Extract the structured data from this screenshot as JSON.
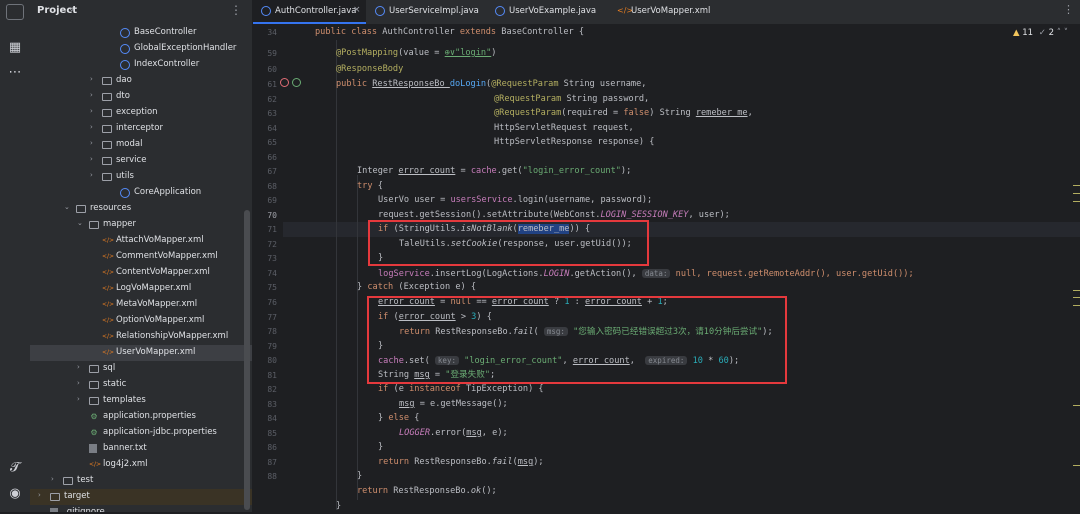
{
  "project_panel": {
    "title": "Project",
    "tree": [
      {
        "label": "BaseController",
        "kind": "class"
      },
      {
        "label": "GlobalExceptionHandler",
        "kind": "class"
      },
      {
        "label": "IndexController",
        "kind": "class"
      },
      {
        "label": "dao",
        "kind": "folder"
      },
      {
        "label": "dto",
        "kind": "folder"
      },
      {
        "label": "exception",
        "kind": "folder"
      },
      {
        "label": "interceptor",
        "kind": "folder"
      },
      {
        "label": "modal",
        "kind": "folder"
      },
      {
        "label": "service",
        "kind": "folder"
      },
      {
        "label": "utils",
        "kind": "folder"
      },
      {
        "label": "CoreApplication",
        "kind": "class"
      },
      {
        "label": "resources",
        "kind": "folder"
      },
      {
        "label": "mapper",
        "kind": "folder"
      },
      {
        "label": "AttachVoMapper.xml",
        "kind": "xml"
      },
      {
        "label": "CommentVoMapper.xml",
        "kind": "xml"
      },
      {
        "label": "ContentVoMapper.xml",
        "kind": "xml"
      },
      {
        "label": "LogVoMapper.xml",
        "kind": "xml"
      },
      {
        "label": "MetaVoMapper.xml",
        "kind": "xml"
      },
      {
        "label": "OptionVoMapper.xml",
        "kind": "xml"
      },
      {
        "label": "RelationshipVoMapper.xml",
        "kind": "xml"
      },
      {
        "label": "UserVoMapper.xml",
        "kind": "xml"
      },
      {
        "label": "sql",
        "kind": "folder"
      },
      {
        "label": "static",
        "kind": "folder"
      },
      {
        "label": "templates",
        "kind": "folder"
      },
      {
        "label": "application.properties",
        "kind": "prop"
      },
      {
        "label": "application-jdbc.properties",
        "kind": "prop"
      },
      {
        "label": "banner.txt",
        "kind": "txt"
      },
      {
        "label": "log4j2.xml",
        "kind": "xml"
      },
      {
        "label": "test",
        "kind": "folder"
      },
      {
        "label": "target",
        "kind": "folder"
      },
      {
        "label": ".gitignore",
        "kind": "txt"
      }
    ]
  },
  "tabs": [
    {
      "label": "AuthController.java"
    },
    {
      "label": "UserServiceImpl.java"
    },
    {
      "label": "UserVoExample.java"
    },
    {
      "label": "UserVoMapper.xml"
    }
  ],
  "inspections": {
    "warnings": "11",
    "weak": "2"
  },
  "editor": {
    "line_numbers": [
      "34",
      "59",
      "60",
      "61",
      "62",
      "63",
      "64",
      "65",
      "66",
      "67",
      "68",
      "69",
      "70",
      "71",
      "72",
      "73",
      "74",
      "75",
      "76",
      "77",
      "78",
      "79",
      "80",
      "81",
      "82",
      "83",
      "84",
      "85",
      "86",
      "87",
      "88"
    ],
    "code": {
      "l34a": "public class ",
      "l34b": "AuthController ",
      "l34c": "extends ",
      "l34d": "BaseController {",
      "l59a": "@PostMapping",
      "l59b": "(value = ",
      "l59c": "⊕∨\"login\"",
      "l59d": ")",
      "l60": "@ResponseBody",
      "l61a": "public ",
      "l61b": "RestResponseBo ",
      "l61c": "doLogin",
      "l61d": "(",
      "l61e": "@RequestParam ",
      "l61f": "String username,",
      "l62a": "@RequestParam ",
      "l62b": "String password,",
      "l63a": "@RequestParam",
      "l63b": "(required = ",
      "l63c": "false",
      "l63d": ") String ",
      "l63e": "remeber_me",
      "l63f": ",",
      "l64": "HttpServletRequest request,",
      "l65": "HttpServletResponse response) {",
      "l67a": "Integer ",
      "l67b": "error_count",
      "l67c": " = ",
      "l67d": "cache",
      "l67e": ".get(",
      "l67f": "\"login_error_count\"",
      "l67g": ");",
      "l68a": "try",
      "l68b": " {",
      "l69a": "UserVo user = ",
      "l69b": "usersService",
      "l69c": ".login(username, password);",
      "l70a": "request.getSession().setAttribute(WebConst.",
      "l70b": "LOGIN_SESSION_KEY",
      "l70c": ", user);",
      "l71a": "if",
      "l71b": " (StringUtils.",
      "l71c": "isNotBlank",
      "l71d": "(",
      "l71e": "remeber_me",
      "l71f": ")) {",
      "l72a": "TaleUtils.",
      "l72b": "setCookie",
      "l72c": "(response, user.getUid());",
      "l73": "}",
      "l74a": "logService",
      "l74b": ".insertLog(LogActions.",
      "l74c": "LOGIN",
      "l74d": ".getAction(), ",
      "l74e": "data:",
      "l74f": " null, request.getRemoteAddr(), user.getUid());",
      "l75a": "} ",
      "l75b": "catch",
      "l75c": " (Exception e) {",
      "l76a": "error_count",
      "l76b": " = ",
      "l76c": "null",
      "l76d": " == ",
      "l76e": "error_count",
      "l76f": " ? ",
      "l76g": "1",
      "l76h": " : ",
      "l76i": "error_count",
      "l76j": " + ",
      "l76k": "1",
      "l76l": ";",
      "l77a": "if",
      "l77b": " (",
      "l77c": "error_count",
      "l77d": " > ",
      "l77e": "3",
      "l77f": ") {",
      "l78a": "return ",
      "l78b": "RestResponseBo.",
      "l78c": "fail",
      "l78d": "( ",
      "l78e": "msg:",
      "l78f": " \"您输入密码已经错误超过3次，请10分钟后尝试\"",
      "l78g": ");",
      "l79": "}",
      "l80a": "cache",
      "l80b": ".set( ",
      "l80c": "key:",
      "l80d": " \"login_error_count\"",
      "l80e": ", ",
      "l80f": "error_count",
      "l80g": ",  ",
      "l80h": "expired:",
      "l80i": " 10",
      "l80j": " * ",
      "l80k": "60",
      "l80l": ");",
      "l81a": "String ",
      "l81b": "msg",
      "l81c": " = ",
      "l81d": "\"登录失败\"",
      "l81e": ";",
      "l82a": "if",
      "l82b": " (e ",
      "l82c": "instanceof",
      "l82d": " TipException) {",
      "l83a": "msg",
      "l83b": " = e.getMessage();",
      "l84a": "} ",
      "l84b": "else",
      "l84c": " {",
      "l85a": "LOGGER",
      "l85b": ".error(",
      "l85c": "msg",
      "l85d": ", e);",
      "l86": "}",
      "l87a": "return ",
      "l87b": "RestResponseBo.",
      "l87c": "fail",
      "l87d": "(",
      "l87e": "msg",
      "l87f": ");",
      "l88": "}",
      "l89a": "return ",
      "l89b": "RestResponseBo.",
      "l89c": "ok",
      "l89d": "();",
      "l90": "}"
    }
  },
  "colors": {
    "accent": "#3574f0",
    "highlight_box": "#e5393d"
  }
}
